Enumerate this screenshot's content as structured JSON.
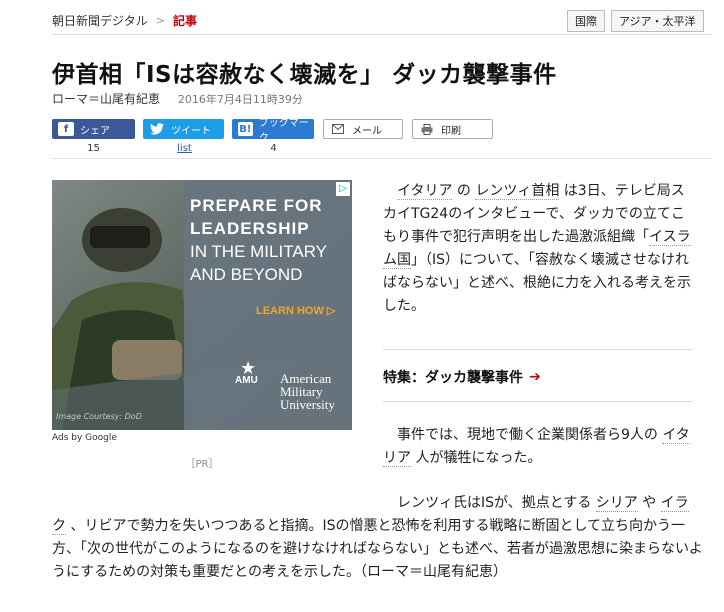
{
  "breadcrumb": {
    "site": "朝日新聞デジタル",
    "separator": ">",
    "current": "記事"
  },
  "tags": [
    "国際",
    "アジア・太平洋"
  ],
  "article": {
    "headline": "伊首相「ISは容赦なく壊滅を」 ダッカ襲撃事件",
    "author": "ローマ＝山尾有紀恵",
    "date": "2016年7月4日11時39分"
  },
  "share": {
    "facebook": {
      "label": "シェア",
      "count": "15"
    },
    "twitter": {
      "label": "ツイート",
      "count": "list"
    },
    "hatena": {
      "label": "ブックマーク",
      "icon_text": "B!",
      "count": "4"
    },
    "mail": {
      "label": "メール"
    },
    "print": {
      "label": "印刷"
    }
  },
  "ad": {
    "headline_1": "PREPARE FOR",
    "headline_2": "LEADERSHIP",
    "headline_3": "IN THE MILITARY",
    "headline_4": "AND BEYOND",
    "cta": "LEARN HOW ▷",
    "brand_short": "AMU",
    "brand_1": "American",
    "brand_2": "Military",
    "brand_3": "University",
    "credit": "Image Courtesy: DoD",
    "ads_by": "Ads by Google",
    "pr": "［PR］"
  },
  "body": {
    "p1_a": "イタリア",
    "p1_b": " の ",
    "p1_c": "レンツィ首相",
    "p1_d": " は3日、テレビ局スカイTG24のインタビューで、ダッカでの立てこもり事件で犯行声明を出した過激派組織「",
    "p1_e": "イスラム国",
    "p1_f": "」（IS）について、「容赦なく壊滅させなければならない」と述べ、根絶に力を入れる考えを示した。",
    "special_label": "特集：ダッカ襲撃事件",
    "p2_a": "事件では、現地で働く企業関係者ら9人の ",
    "p2_b": "イタリア",
    "p2_c": " 人が犠牲になった。",
    "p3_a": "レンツィ氏はISが、拠点とする ",
    "p3_b": "シリア",
    "p3_c": " や ",
    "p3_d": "イラ",
    "p3_e": "ク",
    "p3_f": " 、リビアで勢力を失いつつあると指摘。ISの憎悪と恐怖を利用する戦略に断固として立ち向かう一方、「次の世代がこのようになるのを避けなければならない」とも述べ、若者が過激思想に染まらないようにするための対策も重要だとの考えを示した。（ローマ＝山尾有紀恵）"
  }
}
